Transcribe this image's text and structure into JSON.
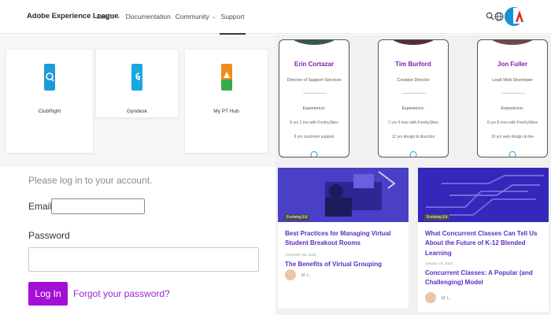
{
  "header": {
    "brand": "Adobe Experience League",
    "nav": [
      {
        "label": "Learn",
        "has_menu": true
      },
      {
        "label": "Documentation",
        "has_menu": false
      },
      {
        "label": "Community",
        "has_menu": true
      },
      {
        "label": "Support",
        "has_menu": false
      }
    ],
    "icons": [
      "search-icon",
      "globe-icon",
      "avatar-icon",
      "adobe-logo"
    ],
    "colors": {
      "avatar": "#1591d6",
      "adobe": "#e1251b"
    }
  },
  "apps": [
    {
      "label": "ClubRight",
      "color": "#1d9ad9"
    },
    {
      "label": "Gyndesk",
      "color": "#17a8e0"
    },
    {
      "label": "My PT Hub",
      "color": "#f08b1a"
    }
  ],
  "login": {
    "message": "Please log in to your account.",
    "email_label": "Email",
    "email_value": "",
    "password_label": "Password",
    "button": "Log In",
    "forgot": "Forgot your password?",
    "colors": {
      "button": "#a50ed6",
      "link": "#9b24d9"
    }
  },
  "team": [
    {
      "name": "Erin Cortazar",
      "role": "Director of Support Services",
      "exp_label": "Experience:",
      "exp1": "8 yrs 1 mo with FreshySites",
      "exp2": "9 yrs customer support"
    },
    {
      "name": "Tim Burford",
      "role": "Creative Director",
      "exp_label": "Experience:",
      "exp1": "7 yrs 4 mos with FreshySites",
      "exp2": "12 yrs design & direction"
    },
    {
      "name": "Jon Fuller",
      "role": "Lead Web Developer",
      "exp_label": "Experience:",
      "exp1": "8 yrs 8 mos with FreshySites",
      "exp2": "19 yrs web design & dev"
    }
  ],
  "posts": [
    {
      "tag": "Evolving Ed",
      "title": "Best Practices for Managing Virtual Student Breakout Rooms",
      "date": "JANUARY 20, 2022",
      "related": "The Benefits of Virtual Grouping",
      "author": "M. L."
    },
    {
      "tag": "Evolving Ed",
      "title": "What Concurrent Classes Can Tell Us About the Future of K-12 Blended Learning",
      "date": "January 19, 2022",
      "related": "Concurrent Classes: A Popular (and Challenging) Model",
      "author": "M. L."
    }
  ]
}
